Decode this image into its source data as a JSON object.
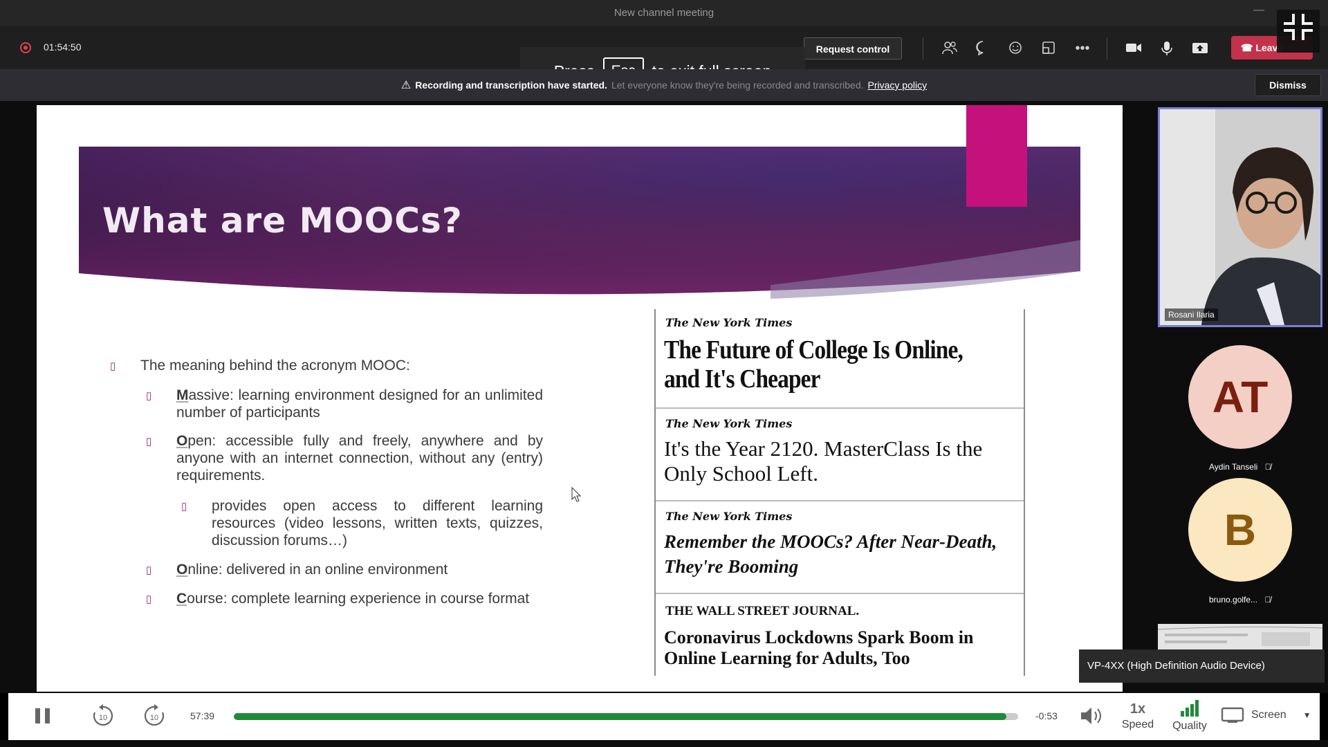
{
  "window": {
    "title": "New channel meeting"
  },
  "toolbar": {
    "timer": "01:54:50",
    "esc_press": "Press",
    "esc_key": "Esc",
    "esc_rest": "to exit full screen",
    "request_control": "Request control",
    "leave": "Leave"
  },
  "banner": {
    "bold_text": "Recording and transcription have started.",
    "faint_text": "Let everyone know they're being recorded and transcribed.",
    "privacy": "Privacy policy",
    "dismiss": "Dismiss"
  },
  "slide": {
    "title": "What are MOOCs?",
    "intro": "The meaning behind the acronym MOOC:",
    "items": [
      {
        "letter": "M",
        "rest": "assive: learning environment designed for an unlimited number of participants"
      },
      {
        "letter": "O",
        "rest": "pen: accessible fully and freely, anywhere and by anyone with an internet connection, without any (entry) requirements."
      },
      {
        "letter": "O",
        "rest": "nline: delivered in an online environment"
      },
      {
        "letter": "C",
        "rest": "ourse: complete learning experience in course format"
      }
    ],
    "sub_item": "provides open access to different learning resources (video lessons, written texts, quizzes, discussion forums…)",
    "news": [
      {
        "masthead": "The New York Times",
        "headline": "The Future of College Is Online, and It's Cheaper"
      },
      {
        "masthead": "The New York Times",
        "headline": "It's the Year 2120. MasterClass Is the Only School Left."
      },
      {
        "masthead": "The New York Times",
        "headline": "Remember the MOOCs? After Near-Death, They're Booming"
      },
      {
        "masthead": "THE WALL STREET JOURNAL.",
        "headline": "Coronavirus Lockdowns Spark Boom in Online Learning for Adults, Too"
      }
    ]
  },
  "participants": {
    "speaker": "Rosani Ilaria",
    "others": [
      {
        "initials": "AT",
        "name": "Aydin Tanseli",
        "bg": "#f3cfc6",
        "fg": "#7a1e10"
      },
      {
        "initials": "B",
        "name": "bruno.golfe...",
        "bg": "#fbe7c0",
        "fg": "#8a5a10"
      }
    ]
  },
  "audio_device": "VP-4XX (High Definition Audio Device)",
  "player": {
    "elapsed": "57:39",
    "remaining": "-0:53",
    "progress": 0.985,
    "speed_value": "1x",
    "speed_label": "Speed",
    "quality_label": "Quality",
    "screen_label": "Screen",
    "skip_back": "10",
    "skip_fwd": "10"
  }
}
